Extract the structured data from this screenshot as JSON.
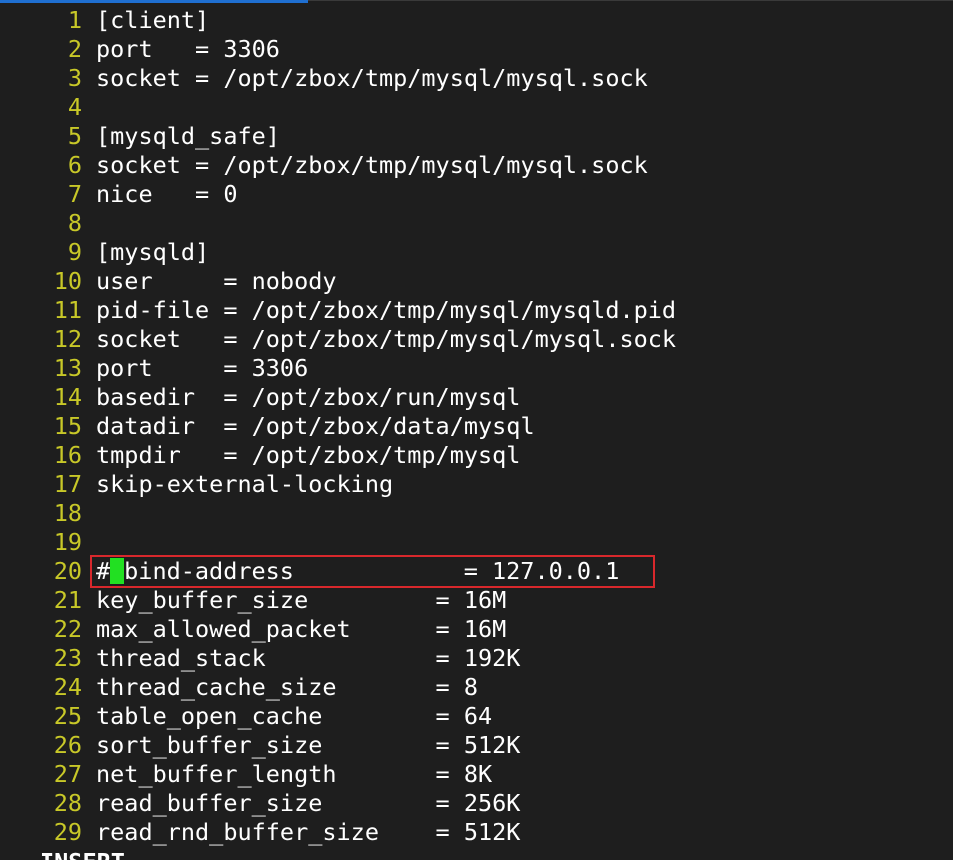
{
  "editor": {
    "lines": [
      {
        "num": "1",
        "text": "[client]"
      },
      {
        "num": "2",
        "text": "port   = 3306"
      },
      {
        "num": "3",
        "text": "socket = /opt/zbox/tmp/mysql/mysql.sock"
      },
      {
        "num": "4",
        "text": ""
      },
      {
        "num": "5",
        "text": "[mysqld_safe]"
      },
      {
        "num": "6",
        "text": "socket = /opt/zbox/tmp/mysql/mysql.sock"
      },
      {
        "num": "7",
        "text": "nice   = 0"
      },
      {
        "num": "8",
        "text": ""
      },
      {
        "num": "9",
        "text": "[mysqld]"
      },
      {
        "num": "10",
        "text": "user     = nobody"
      },
      {
        "num": "11",
        "text": "pid-file = /opt/zbox/tmp/mysql/mysqld.pid"
      },
      {
        "num": "12",
        "text": "socket   = /opt/zbox/tmp/mysql/mysql.sock"
      },
      {
        "num": "13",
        "text": "port     = 3306"
      },
      {
        "num": "14",
        "text": "basedir  = /opt/zbox/run/mysql"
      },
      {
        "num": "15",
        "text": "datadir  = /opt/zbox/data/mysql"
      },
      {
        "num": "16",
        "text": "tmpdir   = /opt/zbox/tmp/mysql"
      },
      {
        "num": "17",
        "text": "skip-external-locking"
      },
      {
        "num": "18",
        "text": ""
      },
      {
        "num": "19",
        "text": ""
      },
      {
        "num": "20",
        "text_before_cursor": "#",
        "text_after_cursor": "bind-address            = 127.0.0.1"
      },
      {
        "num": "21",
        "text": "key_buffer_size         = 16M"
      },
      {
        "num": "22",
        "text": "max_allowed_packet      = 16M"
      },
      {
        "num": "23",
        "text": "thread_stack            = 192K"
      },
      {
        "num": "24",
        "text": "thread_cache_size       = 8"
      },
      {
        "num": "25",
        "text": "table_open_cache        = 64"
      },
      {
        "num": "26",
        "text": "sort_buffer_size        = 512K"
      },
      {
        "num": "27",
        "text": "net_buffer_length       = 8K"
      },
      {
        "num": "28",
        "text": "read_buffer_size        = 256K"
      },
      {
        "num": "29",
        "text": "read_rnd_buffer_size    = 512K"
      }
    ],
    "mode": "INSERT"
  },
  "colors": {
    "background": "#1e1e1e",
    "line_number": "#c8c828",
    "cursor": "#22e022",
    "highlight_border": "#d8282c"
  }
}
